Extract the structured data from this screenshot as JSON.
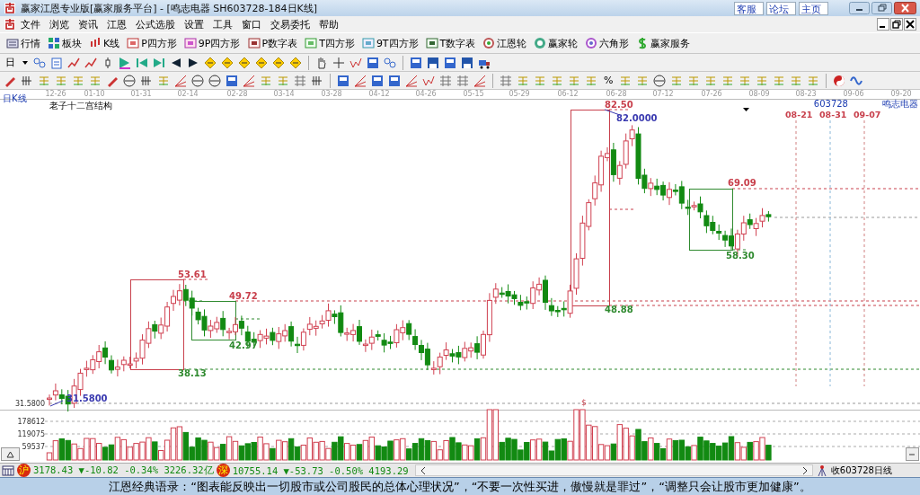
{
  "window": {
    "title": "赢家江恩专业版[赢家服务平台] - [鸣志电器  SH603728-184日K线]",
    "links": [
      "客服",
      "论坛",
      "主页"
    ]
  },
  "menu": [
    "文件",
    "浏览",
    "资讯",
    "江恩",
    "公式选股",
    "设置",
    "工具",
    "窗口",
    "交易委托",
    "帮助"
  ],
  "toolbar": [
    {
      "label": "行情"
    },
    {
      "label": "板块"
    },
    {
      "label": "K线"
    },
    {
      "label": "P四方形"
    },
    {
      "label": "9P四方形"
    },
    {
      "label": "P数字表"
    },
    {
      "label": "T四方形"
    },
    {
      "label": "9T四方形"
    },
    {
      "label": "T数字表"
    },
    {
      "label": "江恩轮"
    },
    {
      "label": "赢家轮"
    },
    {
      "label": "六角形"
    },
    {
      "label": "赢家服务"
    }
  ],
  "period_button": "日",
  "percent_button": "%",
  "chart": {
    "panel_label": "日K线",
    "indicator": "老子十二宫结构",
    "code": "603728",
    "name": "鸣志电器",
    "dates": [
      "12-26",
      "01-10",
      "01-31",
      "02-14",
      "02-28",
      "03-14",
      "03-28",
      "04-12",
      "04-26",
      "05-15",
      "05-29",
      "06-12",
      "06-28",
      "07-12",
      "07-26",
      "08-09",
      "08-23",
      "09-06",
      "09-20"
    ],
    "projection_dates": [
      {
        "text": "08-21",
        "color": "#c8404c"
      },
      {
        "text": "08-31",
        "color": "#c8404c"
      },
      {
        "text": "09-07",
        "color": "#c8404c"
      }
    ],
    "price_labels": [
      {
        "text": "53.61",
        "color": "#c8404c"
      },
      {
        "text": "49.72",
        "color": "#c8404c"
      },
      {
        "text": "42.97",
        "color": "#2f8a2f"
      },
      {
        "text": "38.13",
        "color": "#2f8a2f"
      },
      {
        "text": "82.50",
        "color": "#c8404c"
      },
      {
        "text": "82.0000",
        "color": "#3a3ab0"
      },
      {
        "text": "69.09",
        "color": "#c8404c"
      },
      {
        "text": "58.30",
        "color": "#2f8a2f"
      },
      {
        "text": "48.88",
        "color": "#2f8a2f"
      },
      {
        "text": "31.5800",
        "color": "#3a3ab0"
      }
    ],
    "axis_price": "31.5800",
    "volume_ticks": [
      "178612",
      "119075",
      "59537"
    ],
    "marker": "$"
  },
  "status_bar": {
    "sh_badge": "沪",
    "sh_quote": "3178.43 ▼-10.82 -0.34% 3226.32亿",
    "sz_badge": "深",
    "sz_quote": "10755.14 ▼-53.73 -0.50% 4193.29",
    "stock_label": "收603728日线"
  },
  "marquee": "江恩经典语录：“图表能反映出一切股市或公司股民的总体心理状况”，“不要一次性买进，傲慢就是罪过”，“调整只会让股市更加健康”。"
}
